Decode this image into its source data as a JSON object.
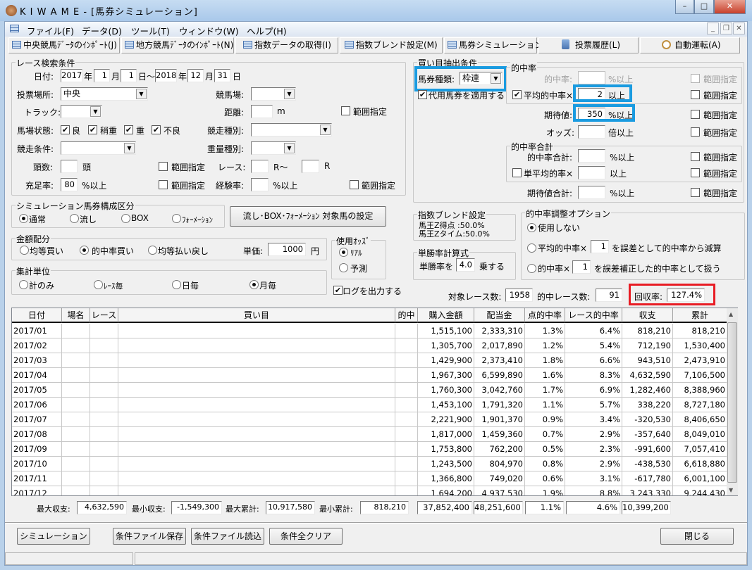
{
  "window": {
    "title": "K I W A M E - [馬券シミュレーション]",
    "min": "–",
    "max": "□",
    "close": "✕"
  },
  "menu": [
    "ファイル(F)",
    "データ(D)",
    "ツール(T)",
    "ウィンドウ(W)",
    "ヘルプ(H)"
  ],
  "mdi": {
    "min": "_",
    "restore": "❐",
    "close": "✕"
  },
  "toolbar": [
    "中央競馬ﾃﾞｰﾀのｲﾝﾎﾟｰﾄ(J)",
    "地方競馬ﾃﾞｰﾀのｲﾝﾎﾟｰﾄ(N)",
    "指数データの取得(I)",
    "指数ブレンド設定(M)",
    "馬券シミュレーション(B)",
    "投票履歴(L)",
    "自動運転(A)"
  ],
  "race": {
    "title": "レース検索条件",
    "date_label": "日付:",
    "from_year": "2017",
    "year_unit": "年",
    "from_month": "1",
    "month_unit": "月",
    "from_day": "1",
    "tilde": "日～",
    "to_year": "2018",
    "to_month": "12",
    "to_day": "31",
    "day_unit": "日",
    "venue_type_label": "投票場所:",
    "venue_type": "中央",
    "venue_label": "競馬場:",
    "venue": "",
    "track_label": "トラック:",
    "track": "",
    "distance_label": "距離:",
    "distance": "",
    "distance_unit": "m",
    "distance_range": "範囲指定",
    "distance_range_checked": false,
    "ground_label": "馬場状態:",
    "ground": [
      {
        "label": "良",
        "checked": true
      },
      {
        "label": "稍重",
        "checked": true
      },
      {
        "label": "重",
        "checked": true
      },
      {
        "label": "不良",
        "checked": true
      }
    ],
    "race_type_label": "競走種別:",
    "race_type": "",
    "race_cond_label": "競走条件:",
    "race_cond": "",
    "weight_label": "重量種別:",
    "weight": "",
    "heads_label": "頭数:",
    "heads": "",
    "heads_unit": "頭",
    "heads_range": "範囲指定",
    "heads_range_checked": false,
    "race_no_label": "レース:",
    "race_from": "",
    "race_from_unit": "R～",
    "race_to": "",
    "race_to_unit": "R",
    "fill_label": "充足率:",
    "fill": "80",
    "fill_unit": "%以上",
    "fill_range": "範囲指定",
    "fill_range_checked": false,
    "exp_label": "経験率:",
    "exp": "",
    "exp_unit": "%以上",
    "exp_range": "範囲指定",
    "exp_range_checked": false
  },
  "buy": {
    "title": "買い目抽出条件",
    "ticket_label": "馬券種類:",
    "ticket": "枠連",
    "substitute": "代用馬券を適用する",
    "substitute_checked": true,
    "hit": {
      "title": "的中率",
      "rate_label": "的中率:",
      "rate": "",
      "rate_unit": "%以上",
      "rate_range": "範囲指定",
      "avg_label": "平均的中率×",
      "avg_checked": true,
      "avg": "2",
      "avg_unit": "以上",
      "avg_range": "範囲指定"
    },
    "ev_label": "期待値:",
    "ev": "350",
    "ev_unit": "%以上",
    "ev_range": "範囲指定",
    "odds_label": "オッズ:",
    "odds": "",
    "odds_unit": "倍以上",
    "odds_range": "範囲指定",
    "sum": {
      "title": "的中率合計",
      "total_label": "的中率合計:",
      "total": "",
      "total_unit": "%以上",
      "total_range": "範囲指定",
      "single_label": "単平均的率×",
      "single_checked": false,
      "single": "",
      "single_unit": "以上",
      "single_range": "範囲指定"
    },
    "evsum_label": "期待値合計:",
    "evsum": "",
    "evsum_unit": "%以上",
    "evsum_range": "範囲指定"
  },
  "composition": {
    "title": "シミュレーション馬券構成区分",
    "options": [
      "通常",
      "流し",
      "BOX",
      "ﾌｫｰﾒｰｼｮﾝ"
    ],
    "selected": 0,
    "button": "流し･BOX･ﾌｫｰﾒｰｼｮﾝ  対象馬の設定"
  },
  "allocation": {
    "title": "金額配分",
    "options": [
      "均等買い",
      "的中率買い",
      "均等払い戻し"
    ],
    "selected": 1,
    "unit_label": "単価:",
    "unit_price": "1000",
    "yen": "円"
  },
  "odds_use": {
    "title": "使用ｵｯｽﾞ",
    "options": [
      "ﾘｱﾙ",
      "予測"
    ],
    "selected": 0
  },
  "aggregate": {
    "title": "集計単位",
    "options": [
      "計のみ",
      "ﾚｰｽ毎",
      "日毎",
      "月毎"
    ],
    "selected": 3
  },
  "log": {
    "label": "ログを出力する",
    "checked": true
  },
  "blend": {
    "title": "指数ブレンド設定",
    "line1": "馬王Z得点  :50.0%",
    "line2": "馬王Zタイム:50.0%"
  },
  "win_calc": {
    "title": "単勝率計算式",
    "prefix": "単勝率を",
    "value": "4.0",
    "suffix": "乗する"
  },
  "adjust": {
    "title": "的中率調整オプション",
    "selected": 0,
    "opt0": "使用しない",
    "opt1_pre": "平均的中率×",
    "opt1_val": "1",
    "opt1_post": "を誤差として的中率から減算",
    "opt2_pre": "的中率×",
    "opt2_val": "1",
    "opt2_post": "を誤差補正した的中率として扱う"
  },
  "stats": {
    "races_label": "対象レース数:",
    "races": "1958",
    "hits_label": "的中レース数:",
    "hits": "91",
    "recovery_label": "回収率:",
    "recovery": "127.4%"
  },
  "highlight_colors": {
    "blue": "#1a9be0",
    "red": "#e81c24"
  },
  "table": {
    "columns": [
      "日付",
      "場名",
      "レース",
      "買い目",
      "的中",
      "購入金額",
      "配当金",
      "点的中率",
      "レース的中率",
      "収支",
      "累計"
    ],
    "rows": [
      [
        "2017/01",
        "",
        "",
        "",
        "",
        "1,515,100",
        "2,333,310",
        "1.3%",
        "6.4%",
        "818,210",
        "818,210"
      ],
      [
        "2017/02",
        "",
        "",
        "",
        "",
        "1,305,700",
        "2,017,890",
        "1.2%",
        "5.4%",
        "712,190",
        "1,530,400"
      ],
      [
        "2017/03",
        "",
        "",
        "",
        "",
        "1,429,900",
        "2,373,410",
        "1.8%",
        "6.6%",
        "943,510",
        "2,473,910"
      ],
      [
        "2017/04",
        "",
        "",
        "",
        "",
        "1,967,300",
        "6,599,890",
        "1.6%",
        "8.3%",
        "4,632,590",
        "7,106,500"
      ],
      [
        "2017/05",
        "",
        "",
        "",
        "",
        "1,760,300",
        "3,042,760",
        "1.7%",
        "6.9%",
        "1,282,460",
        "8,388,960"
      ],
      [
        "2017/06",
        "",
        "",
        "",
        "",
        "1,453,100",
        "1,791,320",
        "1.1%",
        "5.7%",
        "338,220",
        "8,727,180"
      ],
      [
        "2017/07",
        "",
        "",
        "",
        "",
        "2,221,900",
        "1,901,370",
        "0.9%",
        "3.4%",
        "-320,530",
        "8,406,650"
      ],
      [
        "2017/08",
        "",
        "",
        "",
        "",
        "1,817,000",
        "1,459,360",
        "0.7%",
        "2.9%",
        "-357,640",
        "8,049,010"
      ],
      [
        "2017/09",
        "",
        "",
        "",
        "",
        "1,753,800",
        "762,200",
        "0.5%",
        "2.3%",
        "-991,600",
        "7,057,410"
      ],
      [
        "2017/10",
        "",
        "",
        "",
        "",
        "1,243,500",
        "804,970",
        "0.8%",
        "2.9%",
        "-438,530",
        "6,618,880"
      ],
      [
        "2017/11",
        "",
        "",
        "",
        "",
        "1,366,800",
        "749,020",
        "0.6%",
        "3.1%",
        "-617,780",
        "6,001,100"
      ],
      [
        "2017/12",
        "",
        "",
        "",
        "",
        "1,694,200",
        "4,937,530",
        "1.9%",
        "8.8%",
        "3,243,330",
        "9,244,430"
      ]
    ]
  },
  "summary": {
    "max_profit_label": "最大収支:",
    "max_profit": "4,632,590",
    "min_profit_label": "最小収支:",
    "min_profit": "-1,549,300",
    "max_cum_label": "最大累計:",
    "max_cum": "10,917,580",
    "min_cum_label": "最小累計:",
    "min_cum": "818,210",
    "total_purchase": "37,852,400",
    "total_payout": "48,251,600",
    "point_hit": "1.1%",
    "race_hit": "4.6%",
    "total_profit": "10,399,200"
  },
  "buttons": {
    "simulate": "シミュレーション",
    "save": "条件ファイル保存",
    "load": "条件ファイル読込",
    "clear": "条件全クリア",
    "close": "閉じる"
  }
}
